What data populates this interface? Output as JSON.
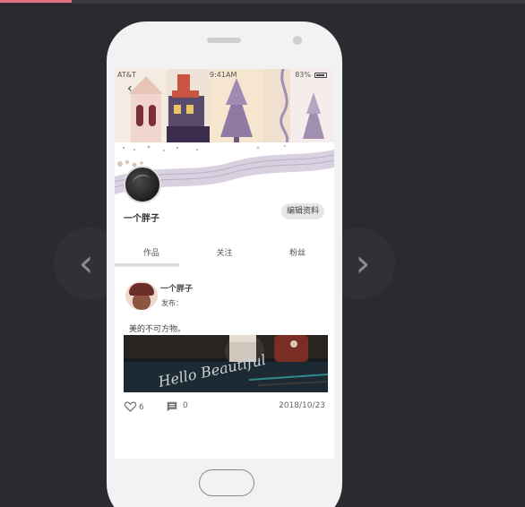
{
  "status_bar": {
    "carrier": "AT&T",
    "time": "9:41AM",
    "battery": "83%"
  },
  "profile": {
    "name": "一个胖子",
    "edit_label": "编辑资料"
  },
  "tabs": [
    {
      "label": "作品"
    },
    {
      "label": "关注"
    },
    {
      "label": "粉丝"
    }
  ],
  "post": {
    "author": "一个胖子",
    "meta": "发布：",
    "text": "美的不可方物。",
    "image_caption": "Hello Beautiful",
    "likes": "6",
    "comments": "0",
    "date": "2018/10/23"
  },
  "icons": {
    "back": "chevron-left-icon",
    "prev": "chevron-left-icon",
    "next": "chevron-right-icon",
    "like": "heart-icon",
    "comment": "comment-icon"
  },
  "colors": {
    "background": "#2c2a31",
    "accent": "#e36f7f",
    "phone": "#f2f2f2"
  }
}
